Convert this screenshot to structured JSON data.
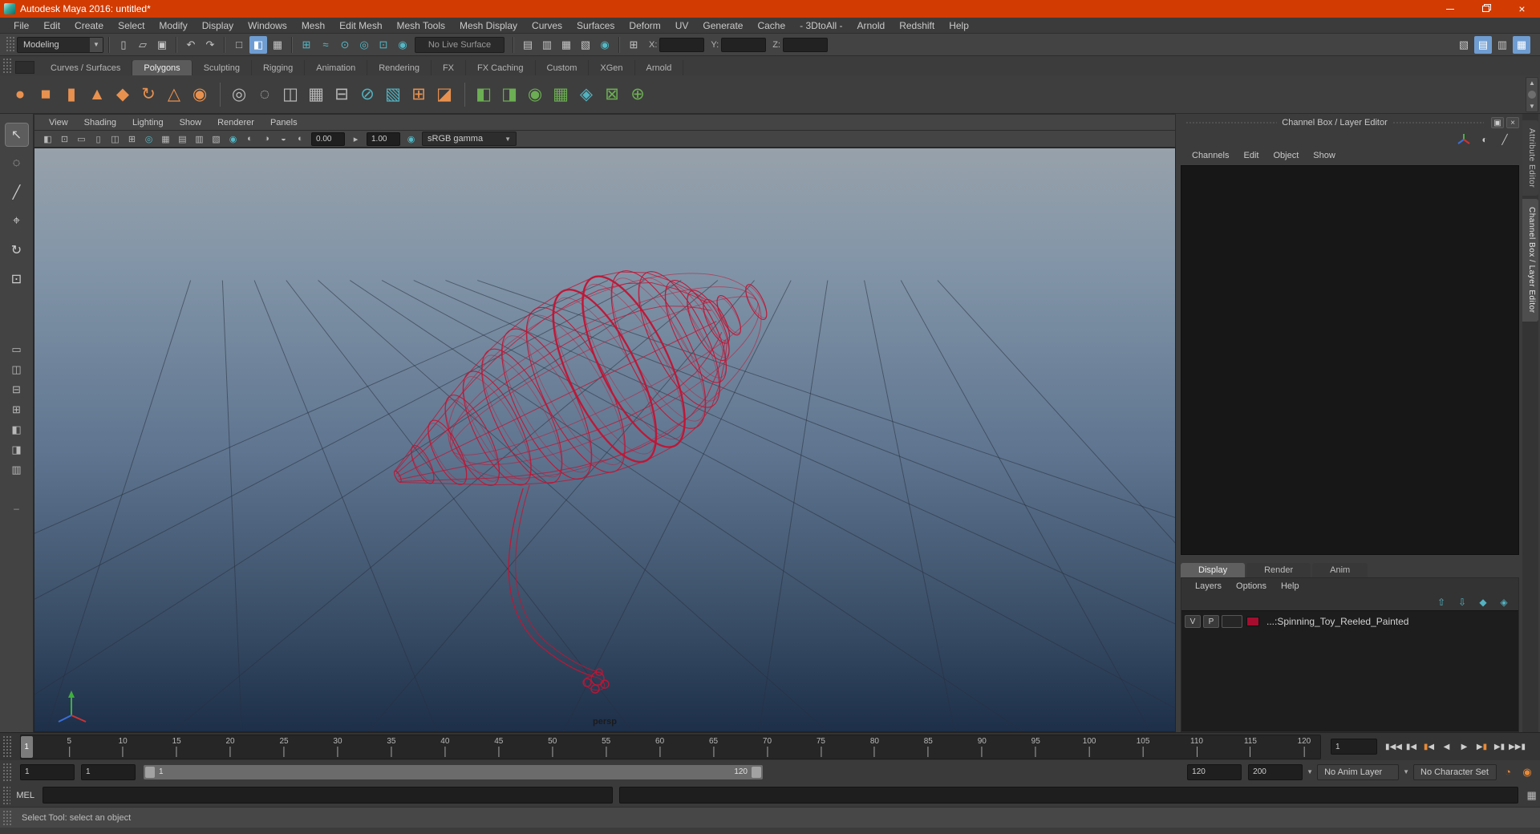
{
  "colors": {
    "titlebar": "#d23b02",
    "accent_blue": "#6f9dd1",
    "teal": "#53b2c0",
    "shelf_orange": "#e8914f",
    "green": "#6cae53",
    "orange": "#e98935",
    "wire_red": "#c11535",
    "layer_swatch": "#a50d2e"
  },
  "window": {
    "title": "Autodesk Maya 2016: untitled*"
  },
  "menu_bar": [
    "File",
    "Edit",
    "Create",
    "Select",
    "Modify",
    "Display",
    "Windows",
    "Mesh",
    "Edit Mesh",
    "Mesh Tools",
    "Mesh Display",
    "Curves",
    "Surfaces",
    "Deform",
    "UV",
    "Generate",
    "Cache",
    "- 3DtoAll -",
    "Arnold",
    "Redshift",
    "Help"
  ],
  "status_line": {
    "menu_set": "Modeling",
    "live_surface": "No Live Surface",
    "coords": {
      "x": "X:",
      "y": "Y:",
      "z": "Z:"
    },
    "file_icons": [
      {
        "name": "new-scene-icon",
        "glyph": "▯"
      },
      {
        "name": "open-scene-icon",
        "glyph": "▱"
      },
      {
        "name": "save-scene-icon",
        "glyph": "▣"
      }
    ],
    "history_icons": [
      {
        "name": "undo-icon",
        "glyph": "↶"
      },
      {
        "name": "redo-icon",
        "glyph": "↷"
      }
    ],
    "selection_icons": [
      {
        "name": "select-hierarchy-icon",
        "glyph": "□"
      },
      {
        "name": "select-object-icon",
        "glyph": "◧",
        "active": true
      },
      {
        "name": "select-component-icon",
        "glyph": "▦"
      }
    ],
    "snap_icons": [
      {
        "name": "snap-grid-icon",
        "glyph": "⊞",
        "teal": true
      },
      {
        "name": "snap-curve-icon",
        "glyph": "≈",
        "teal": true
      },
      {
        "name": "snap-point-icon",
        "glyph": "⊙",
        "teal": true
      },
      {
        "name": "snap-projected-center-icon",
        "glyph": "◎",
        "teal": true
      },
      {
        "name": "snap-view-plane-icon",
        "glyph": "⊡",
        "teal": true
      },
      {
        "name": "make-live-icon",
        "glyph": "◉",
        "teal": true
      }
    ],
    "render_icons": [
      {
        "name": "render-frame-icon",
        "glyph": "▤"
      },
      {
        "name": "ipr-render-icon",
        "glyph": "▥"
      },
      {
        "name": "render-sequence-icon",
        "glyph": "▦"
      },
      {
        "name": "render-settings-icon",
        "glyph": "▧"
      },
      {
        "name": "hypershade-icon",
        "glyph": "◉",
        "teal": true
      }
    ],
    "symmetry_icons": [
      {
        "name": "symmetry-icon",
        "glyph": "⊞"
      }
    ],
    "sidebar_toggles": [
      {
        "name": "modeling-toolkit-toggle",
        "glyph": "▧"
      },
      {
        "name": "attribute-editor-toggle",
        "glyph": "▤",
        "active": true
      },
      {
        "name": "tool-settings-toggle",
        "glyph": "▥"
      },
      {
        "name": "channel-box-toggle",
        "glyph": "▦",
        "active": true
      }
    ]
  },
  "shelf": {
    "active_tab": "Polygons",
    "tabs": [
      "Curves / Surfaces",
      "Polygons",
      "Sculpting",
      "Rigging",
      "Animation",
      "Rendering",
      "FX",
      "FX Caching",
      "Custom",
      "XGen",
      "Arnold"
    ],
    "icons": [
      {
        "name": "poly-sphere-icon",
        "glyph": "●",
        "c": "orange"
      },
      {
        "name": "poly-cube-icon",
        "glyph": "■",
        "c": "orange"
      },
      {
        "name": "poly-cylinder-icon",
        "glyph": "▮",
        "c": "orange"
      },
      {
        "name": "poly-cone-icon",
        "glyph": "▲",
        "c": "orange"
      },
      {
        "name": "poly-platonic-icon",
        "glyph": "◆",
        "c": "orange"
      },
      {
        "name": "poly-helix-icon",
        "glyph": "↻",
        "c": "orange"
      },
      {
        "name": "poly-pyramid-icon",
        "glyph": "△",
        "c": "orange"
      },
      {
        "name": "poly-pipe-icon",
        "glyph": "◉",
        "c": "orange"
      },
      {
        "divider": true
      },
      {
        "name": "smooth-icon",
        "glyph": "◎",
        "c": "gray"
      },
      {
        "name": "smooth-preview-icon",
        "glyph": "◌",
        "c": "gray"
      },
      {
        "name": "mirror-geometry-icon",
        "glyph": "◫",
        "c": "gray"
      },
      {
        "name": "reduce-icon",
        "glyph": "▦",
        "c": "gray"
      },
      {
        "name": "boolean-icon",
        "glyph": "⊟",
        "c": "gray"
      },
      {
        "name": "multi-cut-icon",
        "glyph": "⊘",
        "c": "teal"
      },
      {
        "name": "quad-draw-icon",
        "glyph": "▧",
        "c": "teal"
      },
      {
        "name": "extrude-icon",
        "glyph": "⊞",
        "c": "orange"
      },
      {
        "name": "bevel-icon",
        "glyph": "◪",
        "c": "orange"
      },
      {
        "divider": true
      },
      {
        "name": "uv-planar-icon",
        "glyph": "◧",
        "c": "green"
      },
      {
        "name": "uv-cylindrical-icon",
        "glyph": "◨",
        "c": "green"
      },
      {
        "name": "uv-spherical-icon",
        "glyph": "◉",
        "c": "green"
      },
      {
        "name": "uv-automatic-icon",
        "glyph": "▦",
        "c": "green"
      },
      {
        "name": "uv-contour-stretch-icon",
        "glyph": "◈",
        "c": "teal"
      },
      {
        "name": "uv-cut-sew-icon",
        "glyph": "⊠",
        "c": "green"
      },
      {
        "name": "uv-optimize-icon",
        "glyph": "⊕",
        "c": "green"
      }
    ]
  },
  "toolbox": {
    "tools": [
      {
        "name": "select-tool",
        "glyph": "↖",
        "active": true
      },
      {
        "name": "lasso-tool",
        "glyph": "◌"
      },
      {
        "name": "paint-select-tool",
        "glyph": "╱"
      },
      {
        "name": "move-tool",
        "glyph": "⌖"
      },
      {
        "name": "rotate-tool",
        "glyph": "↻"
      },
      {
        "name": "scale-tool",
        "glyph": "⊡"
      }
    ],
    "layouts": [
      {
        "name": "layout-single-pane",
        "glyph": "▭"
      },
      {
        "name": "layout-two-panes-side",
        "glyph": "◫"
      },
      {
        "name": "layout-two-panes-stacked",
        "glyph": "⊟"
      },
      {
        "name": "layout-four-panes",
        "glyph": "⊞"
      },
      {
        "name": "layout-persp-outliner",
        "glyph": "◧"
      },
      {
        "name": "layout-persp-graph",
        "glyph": "◨"
      },
      {
        "name": "layout-hypershade",
        "glyph": "▥"
      }
    ],
    "more_label": "–"
  },
  "panel": {
    "menus": [
      "View",
      "Shading",
      "Lighting",
      "Show",
      "Renderer",
      "Panels"
    ],
    "toolbar_icons": [
      {
        "name": "renderer-select-icon",
        "glyph": "◧"
      },
      {
        "name": "lock-camera-icon",
        "glyph": "⊡"
      },
      {
        "name": "camera-attributes-icon",
        "glyph": "▭"
      },
      {
        "name": "bookmark-icon",
        "glyph": "▯"
      },
      {
        "name": "image-plane-icon",
        "glyph": "◫"
      },
      {
        "name": "two-d-pan-zoom-icon",
        "glyph": "⊞"
      },
      {
        "name": "isolate-select-icon",
        "glyph": "◎",
        "teal": true
      },
      {
        "name": "grid-toggle-icon",
        "glyph": "▦"
      },
      {
        "name": "film-gate-icon",
        "glyph": "▤"
      },
      {
        "name": "resolution-gate-icon",
        "glyph": "▥"
      },
      {
        "name": "gate-mask-icon",
        "glyph": "▧"
      },
      {
        "name": "default-lighting-icon",
        "glyph": "◉",
        "teal": true
      },
      {
        "name": "shadows-icon",
        "glyph": "◐"
      },
      {
        "name": "ambient-occlusion-icon",
        "glyph": "◑"
      },
      {
        "name": "anti-aliasing-icon",
        "glyph": "◒"
      }
    ],
    "exposure": "0.00",
    "gamma": "1.00",
    "color_space": "sRGB gamma",
    "camera_label": "persp"
  },
  "channel_box": {
    "header": "Channel Box / Layer Editor",
    "menus": [
      "Channels",
      "Edit",
      "Object",
      "Show"
    ],
    "header_icons": [
      {
        "name": "display-toggle-icon",
        "glyph": "◐"
      },
      {
        "name": "pencil-icon",
        "glyph": "╱"
      }
    ]
  },
  "layer_editor": {
    "tabs": [
      "Display",
      "Render",
      "Anim"
    ],
    "active_tab": "Display",
    "menus": [
      "Layers",
      "Options",
      "Help"
    ],
    "toolbar_icons": [
      {
        "name": "layer-move-up-button",
        "glyph": "⇧"
      },
      {
        "name": "layer-move-down-button",
        "glyph": "⇩"
      },
      {
        "name": "create-empty-layer-button",
        "glyph": "◆"
      },
      {
        "name": "create-layer-from-selected-button",
        "glyph": "◈"
      }
    ],
    "layers": [
      {
        "visible": "V",
        "playback": "P",
        "name": "...:Spinning_Toy_Reeled_Painted"
      }
    ]
  },
  "side_tabs": [
    {
      "label": "Attribute Editor",
      "active": false
    },
    {
      "label": "Channel Box / Layer Editor",
      "active": true
    }
  ],
  "time_slider": {
    "tick_labels": [
      5,
      10,
      15,
      20,
      25,
      30,
      35,
      40,
      45,
      50,
      55,
      60,
      65,
      70,
      75,
      80,
      85,
      90,
      95,
      100,
      105,
      110,
      115,
      120
    ],
    "ruler_start": 0.5,
    "ruler_end": 121.5,
    "current_frame": 1,
    "frame_field": "1",
    "playback_buttons": [
      {
        "name": "go-to-start-button",
        "pre": "▮",
        "glyph": "◀◀"
      },
      {
        "name": "step-back-frame-button",
        "pre": "▮",
        "glyph": "◀"
      },
      {
        "name": "step-back-key-button",
        "pre": "▮",
        "glyph": "◀",
        "accent": true
      },
      {
        "name": "play-backward-button",
        "glyph": "◀"
      },
      {
        "name": "play-forward-button",
        "glyph": "▶"
      },
      {
        "name": "step-forward-key-button",
        "glyph": "▶",
        "post": "▮",
        "accent": true
      },
      {
        "name": "step-forward-frame-button",
        "glyph": "▶",
        "post": "▮"
      },
      {
        "name": "go-to-end-button",
        "glyph": "▶▶",
        "post": "▮"
      }
    ]
  },
  "range_slider": {
    "anim_start": "1",
    "playback_start": "1",
    "bar_start_label": "1",
    "bar_end_label": "120",
    "playback_end": "120",
    "anim_end": "200",
    "anim_layer": "No Anim Layer",
    "character_set": "No Character Set",
    "icons": [
      {
        "name": "auto-keyframe-toggle",
        "glyph": "◔"
      },
      {
        "name": "anim-preferences-button",
        "glyph": "◉"
      }
    ]
  },
  "command_line": {
    "label": "MEL",
    "input_value": "",
    "result_value": ""
  },
  "help_line": {
    "text": "Select Tool: select an object"
  }
}
